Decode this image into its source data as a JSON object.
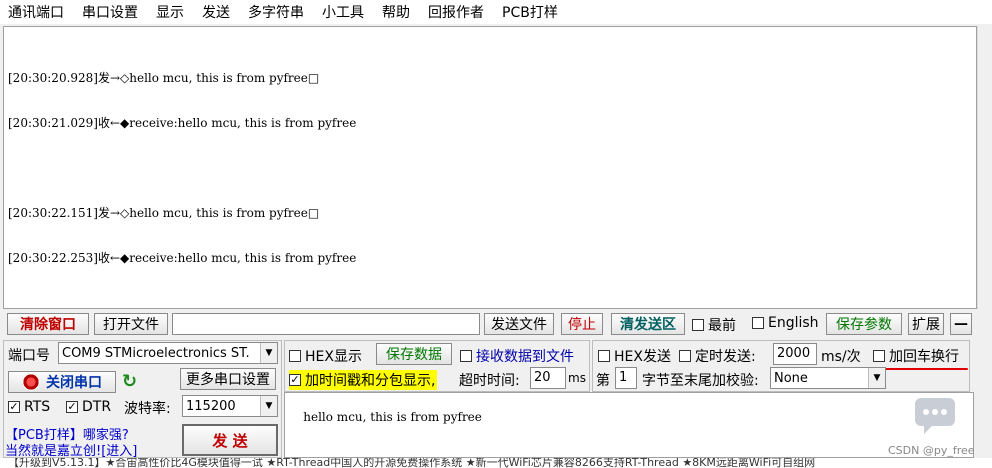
{
  "menu": [
    "通讯端口",
    "串口设置",
    "显示",
    "发送",
    "多字符串",
    "小工具",
    "帮助",
    "回报作者",
    "PCB打样"
  ],
  "receive": {
    "lines": [
      "[20:30:20.928]发→◇hello mcu, this is from pyfree□",
      "[20:30:21.029]收←◆receive:hello mcu, this is from pyfree",
      "",
      "[20:30:22.151]发→◇hello mcu, this is from pyfree□",
      "[20:30:22.253]收←◆receive:hello mcu, this is from pyfree"
    ]
  },
  "toolbar": {
    "clear_window": "清除窗口",
    "open_file": "打开文件",
    "file_path": "",
    "send_file": "发送文件",
    "stop": "停止",
    "clear_send": "清发送区",
    "topmost": "最前",
    "english": "English",
    "save_params": "保存参数",
    "expand": "扩展",
    "collapse": "—"
  },
  "port": {
    "label": "端口号",
    "value": "COM9 STMicroelectronics ST.",
    "close_port": "关闭串口",
    "more_settings": "更多串口设置",
    "rts": "RTS",
    "dtr": "DTR",
    "baud_label": "波特率:",
    "baud": "115200"
  },
  "display": {
    "hex_show": "HEX显示",
    "save_data": "保存数据",
    "recv_to_file": "接收数据到文件",
    "timestamp": "加时间戳和分包显示,",
    "timeout_label": "超时时间:",
    "timeout": "20",
    "timeout_unit": "ms"
  },
  "send": {
    "hex_send": "HEX发送",
    "timed_send": "定时发送:",
    "interval": "2000",
    "interval_unit": "ms/次",
    "append_crlf": "加回车换行",
    "page_label": "第",
    "page_value": "1",
    "checksum_label": "字节至末尾加校验:",
    "checksum": "None",
    "send_button": "发  送",
    "content": "hello mcu, this is from pyfree"
  },
  "ad": {
    "line1": "【PCB打样】哪家强?",
    "line2": "当然就是嘉立创![进入]"
  },
  "status_bar": "【升级到V5.13.1】★合宙高性价比4G模块值得一试 ★RT-Thread中国人的开源免费操作系统 ★新一代WiFi芯片兼容8266支持RT-Thread ★8KM远距离WiFi可自组网",
  "watermark": "CSDN @py_free"
}
